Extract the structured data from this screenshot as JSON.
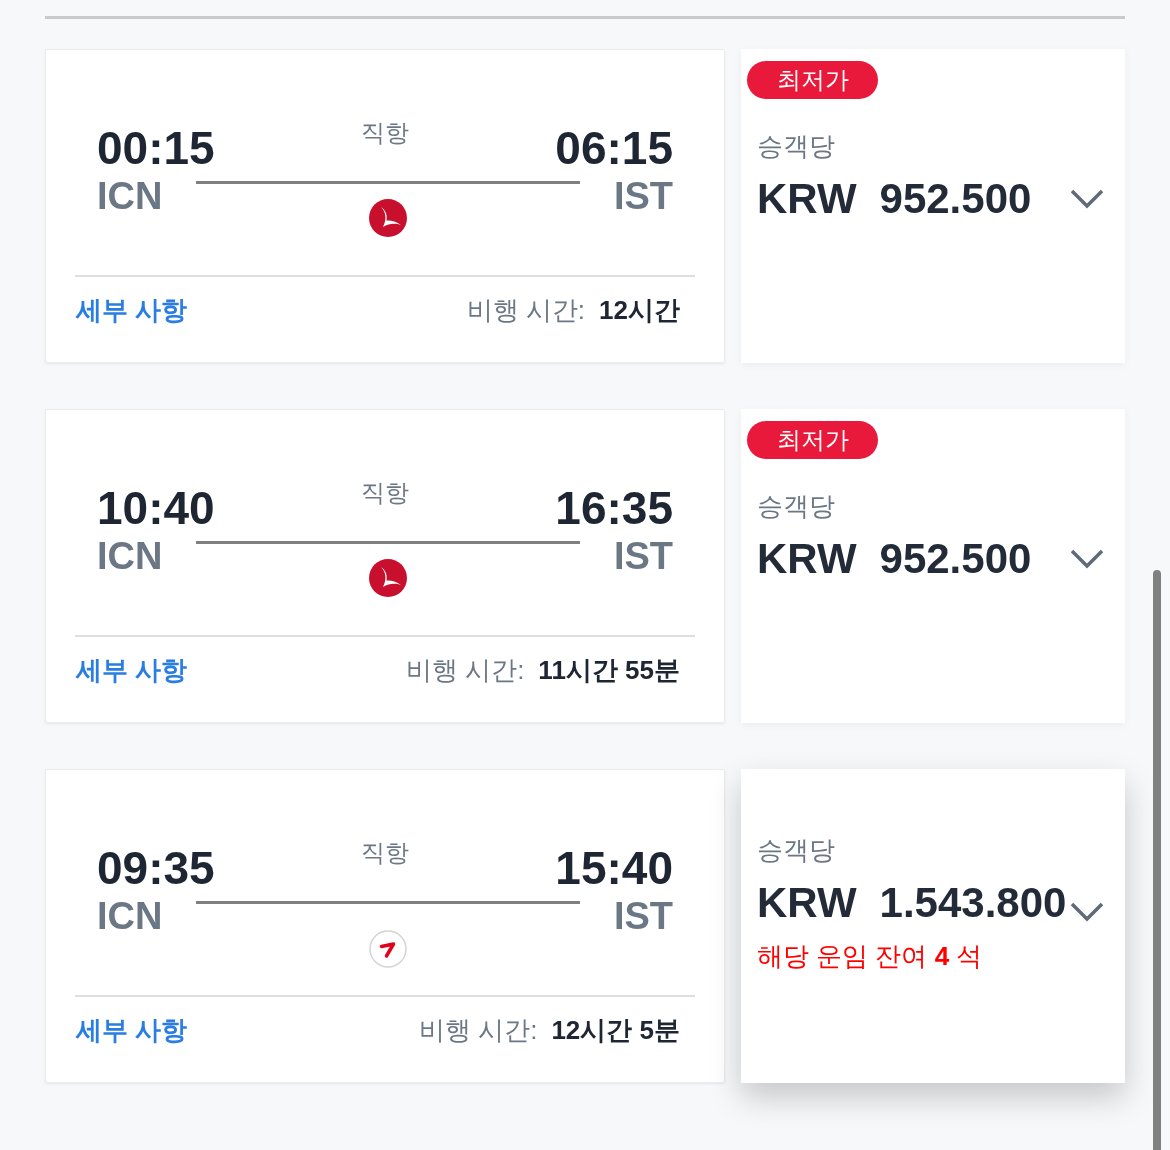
{
  "flights": [
    {
      "departure": {
        "time": "00:15",
        "airport": "ICN"
      },
      "stops": "직항",
      "arrival": {
        "time": "06:15",
        "airport": "IST"
      },
      "logo": {
        "kind": "disc"
      },
      "details_link": "세부 사항",
      "duration_label": "비행 시간:",
      "duration": "12시간",
      "fare": {
        "badge": "최저가",
        "per_passenger": "승객당",
        "currency": "KRW",
        "amount": "952.500",
        "hovered": false
      }
    },
    {
      "departure": {
        "time": "10:40",
        "airport": "ICN"
      },
      "stops": "직항",
      "arrival": {
        "time": "16:35",
        "airport": "IST"
      },
      "logo": {
        "kind": "disc"
      },
      "details_link": "세부 사항",
      "duration_label": "비행 시간:",
      "duration": "11시간 55분",
      "fare": {
        "badge": "최저가",
        "per_passenger": "승객당",
        "currency": "KRW",
        "amount": "952.500",
        "hovered": false
      }
    },
    {
      "departure": {
        "time": "09:35",
        "airport": "ICN"
      },
      "stops": "직항",
      "arrival": {
        "time": "15:40",
        "airport": "IST"
      },
      "logo": {
        "kind": "outline"
      },
      "details_link": "세부 사항",
      "duration_label": "비행 시간:",
      "duration": "12시간 5분",
      "fare": {
        "per_passenger": "승객당",
        "currency": "KRW",
        "amount": "1.543.800",
        "seats_left": "해당 운임 잔여 **4** 석",
        "hovered": true
      }
    }
  ]
}
